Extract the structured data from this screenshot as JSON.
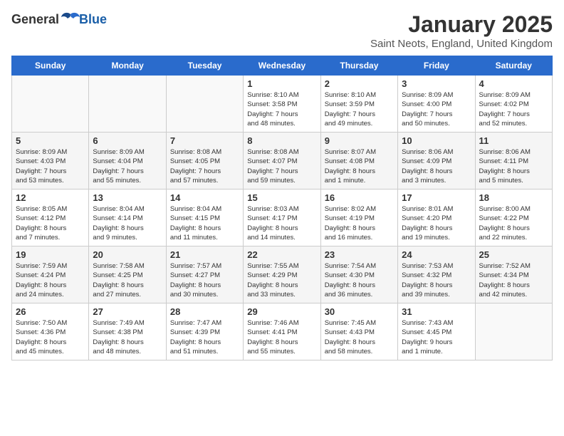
{
  "header": {
    "logo_general": "General",
    "logo_blue": "Blue",
    "title": "January 2025",
    "subtitle": "Saint Neots, England, United Kingdom"
  },
  "weekdays": [
    "Sunday",
    "Monday",
    "Tuesday",
    "Wednesday",
    "Thursday",
    "Friday",
    "Saturday"
  ],
  "weeks": [
    [
      {
        "day": "",
        "info": ""
      },
      {
        "day": "",
        "info": ""
      },
      {
        "day": "",
        "info": ""
      },
      {
        "day": "1",
        "info": "Sunrise: 8:10 AM\nSunset: 3:58 PM\nDaylight: 7 hours\nand 48 minutes."
      },
      {
        "day": "2",
        "info": "Sunrise: 8:10 AM\nSunset: 3:59 PM\nDaylight: 7 hours\nand 49 minutes."
      },
      {
        "day": "3",
        "info": "Sunrise: 8:09 AM\nSunset: 4:00 PM\nDaylight: 7 hours\nand 50 minutes."
      },
      {
        "day": "4",
        "info": "Sunrise: 8:09 AM\nSunset: 4:02 PM\nDaylight: 7 hours\nand 52 minutes."
      }
    ],
    [
      {
        "day": "5",
        "info": "Sunrise: 8:09 AM\nSunset: 4:03 PM\nDaylight: 7 hours\nand 53 minutes."
      },
      {
        "day": "6",
        "info": "Sunrise: 8:09 AM\nSunset: 4:04 PM\nDaylight: 7 hours\nand 55 minutes."
      },
      {
        "day": "7",
        "info": "Sunrise: 8:08 AM\nSunset: 4:05 PM\nDaylight: 7 hours\nand 57 minutes."
      },
      {
        "day": "8",
        "info": "Sunrise: 8:08 AM\nSunset: 4:07 PM\nDaylight: 7 hours\nand 59 minutes."
      },
      {
        "day": "9",
        "info": "Sunrise: 8:07 AM\nSunset: 4:08 PM\nDaylight: 8 hours\nand 1 minute."
      },
      {
        "day": "10",
        "info": "Sunrise: 8:06 AM\nSunset: 4:09 PM\nDaylight: 8 hours\nand 3 minutes."
      },
      {
        "day": "11",
        "info": "Sunrise: 8:06 AM\nSunset: 4:11 PM\nDaylight: 8 hours\nand 5 minutes."
      }
    ],
    [
      {
        "day": "12",
        "info": "Sunrise: 8:05 AM\nSunset: 4:12 PM\nDaylight: 8 hours\nand 7 minutes."
      },
      {
        "day": "13",
        "info": "Sunrise: 8:04 AM\nSunset: 4:14 PM\nDaylight: 8 hours\nand 9 minutes."
      },
      {
        "day": "14",
        "info": "Sunrise: 8:04 AM\nSunset: 4:15 PM\nDaylight: 8 hours\nand 11 minutes."
      },
      {
        "day": "15",
        "info": "Sunrise: 8:03 AM\nSunset: 4:17 PM\nDaylight: 8 hours\nand 14 minutes."
      },
      {
        "day": "16",
        "info": "Sunrise: 8:02 AM\nSunset: 4:19 PM\nDaylight: 8 hours\nand 16 minutes."
      },
      {
        "day": "17",
        "info": "Sunrise: 8:01 AM\nSunset: 4:20 PM\nDaylight: 8 hours\nand 19 minutes."
      },
      {
        "day": "18",
        "info": "Sunrise: 8:00 AM\nSunset: 4:22 PM\nDaylight: 8 hours\nand 22 minutes."
      }
    ],
    [
      {
        "day": "19",
        "info": "Sunrise: 7:59 AM\nSunset: 4:24 PM\nDaylight: 8 hours\nand 24 minutes."
      },
      {
        "day": "20",
        "info": "Sunrise: 7:58 AM\nSunset: 4:25 PM\nDaylight: 8 hours\nand 27 minutes."
      },
      {
        "day": "21",
        "info": "Sunrise: 7:57 AM\nSunset: 4:27 PM\nDaylight: 8 hours\nand 30 minutes."
      },
      {
        "day": "22",
        "info": "Sunrise: 7:55 AM\nSunset: 4:29 PM\nDaylight: 8 hours\nand 33 minutes."
      },
      {
        "day": "23",
        "info": "Sunrise: 7:54 AM\nSunset: 4:30 PM\nDaylight: 8 hours\nand 36 minutes."
      },
      {
        "day": "24",
        "info": "Sunrise: 7:53 AM\nSunset: 4:32 PM\nDaylight: 8 hours\nand 39 minutes."
      },
      {
        "day": "25",
        "info": "Sunrise: 7:52 AM\nSunset: 4:34 PM\nDaylight: 8 hours\nand 42 minutes."
      }
    ],
    [
      {
        "day": "26",
        "info": "Sunrise: 7:50 AM\nSunset: 4:36 PM\nDaylight: 8 hours\nand 45 minutes."
      },
      {
        "day": "27",
        "info": "Sunrise: 7:49 AM\nSunset: 4:38 PM\nDaylight: 8 hours\nand 48 minutes."
      },
      {
        "day": "28",
        "info": "Sunrise: 7:47 AM\nSunset: 4:39 PM\nDaylight: 8 hours\nand 51 minutes."
      },
      {
        "day": "29",
        "info": "Sunrise: 7:46 AM\nSunset: 4:41 PM\nDaylight: 8 hours\nand 55 minutes."
      },
      {
        "day": "30",
        "info": "Sunrise: 7:45 AM\nSunset: 4:43 PM\nDaylight: 8 hours\nand 58 minutes."
      },
      {
        "day": "31",
        "info": "Sunrise: 7:43 AM\nSunset: 4:45 PM\nDaylight: 9 hours\nand 1 minute."
      },
      {
        "day": "",
        "info": ""
      }
    ]
  ]
}
